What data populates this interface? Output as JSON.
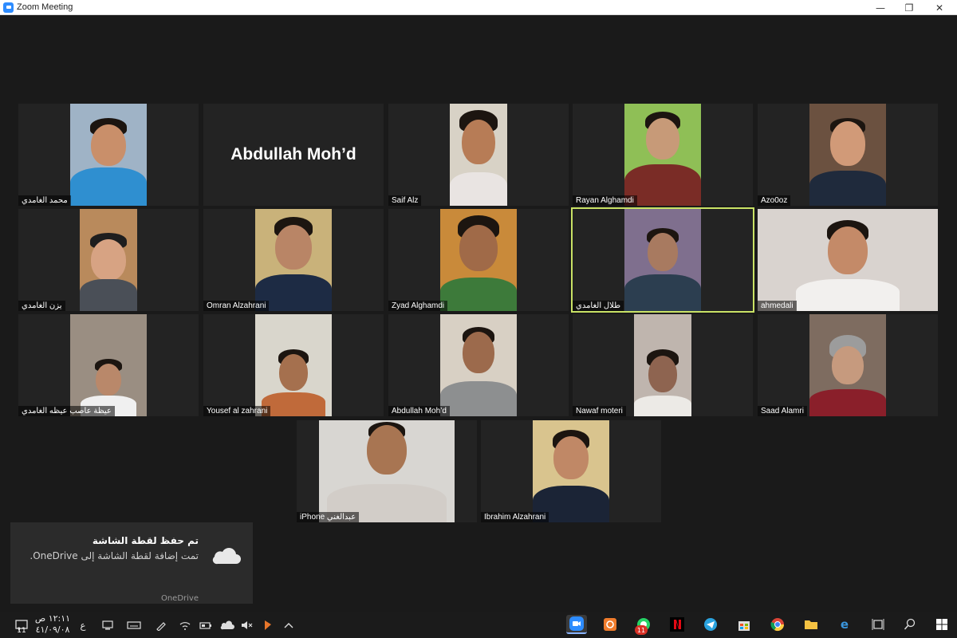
{
  "window": {
    "title": "Zoom Meeting",
    "minimize": "—",
    "maximize": "❐",
    "close": "✕"
  },
  "participants": [
    {
      "name": "محمد الغامدي",
      "video": true
    },
    {
      "name": "Abdullah Moh’d",
      "video": false
    },
    {
      "name": "Saif Alz",
      "video": true
    },
    {
      "name": "Rayan Alghamdi",
      "video": true
    },
    {
      "name": "Azo0oz",
      "video": true
    },
    {
      "name": "يزن الغامدي",
      "video": true
    },
    {
      "name": "Omran Alzahrani",
      "video": true
    },
    {
      "name": "Zyad Alghamdi",
      "video": true
    },
    {
      "name": "طلال الغامدي",
      "video": true,
      "active_speaker": true
    },
    {
      "name": "ahmedali",
      "video": true
    },
    {
      "name": "عيظة عاصب عيظه الغامدي",
      "video": true
    },
    {
      "name": "Yousef al zahrani",
      "video": true
    },
    {
      "name": "Abdullah Moh’d",
      "video": true
    },
    {
      "name": "Nawaf moteri",
      "video": true
    },
    {
      "name": "Saad Alamri",
      "video": true
    },
    {
      "name": "iPhone عبدالغني",
      "video": true
    },
    {
      "name": "Ibrahim Alzahrani",
      "video": true
    }
  ],
  "notification": {
    "title": "تم حفظ لقطة الشاشة",
    "body": "تمت إضافة لقطة الشاشة إلى OneDrive.",
    "source": "OneDrive",
    "icon": "onedrive-cloud-icon"
  },
  "taskbar": {
    "time": "١٢:١١ ص",
    "date": "٤١/٠٩/٠٨",
    "lang": "ع",
    "notification_count": "11",
    "active_app": "zoom"
  },
  "colors": {
    "active_speaker_border": "#c9e265",
    "zoom_blue": "#2d8cff"
  }
}
